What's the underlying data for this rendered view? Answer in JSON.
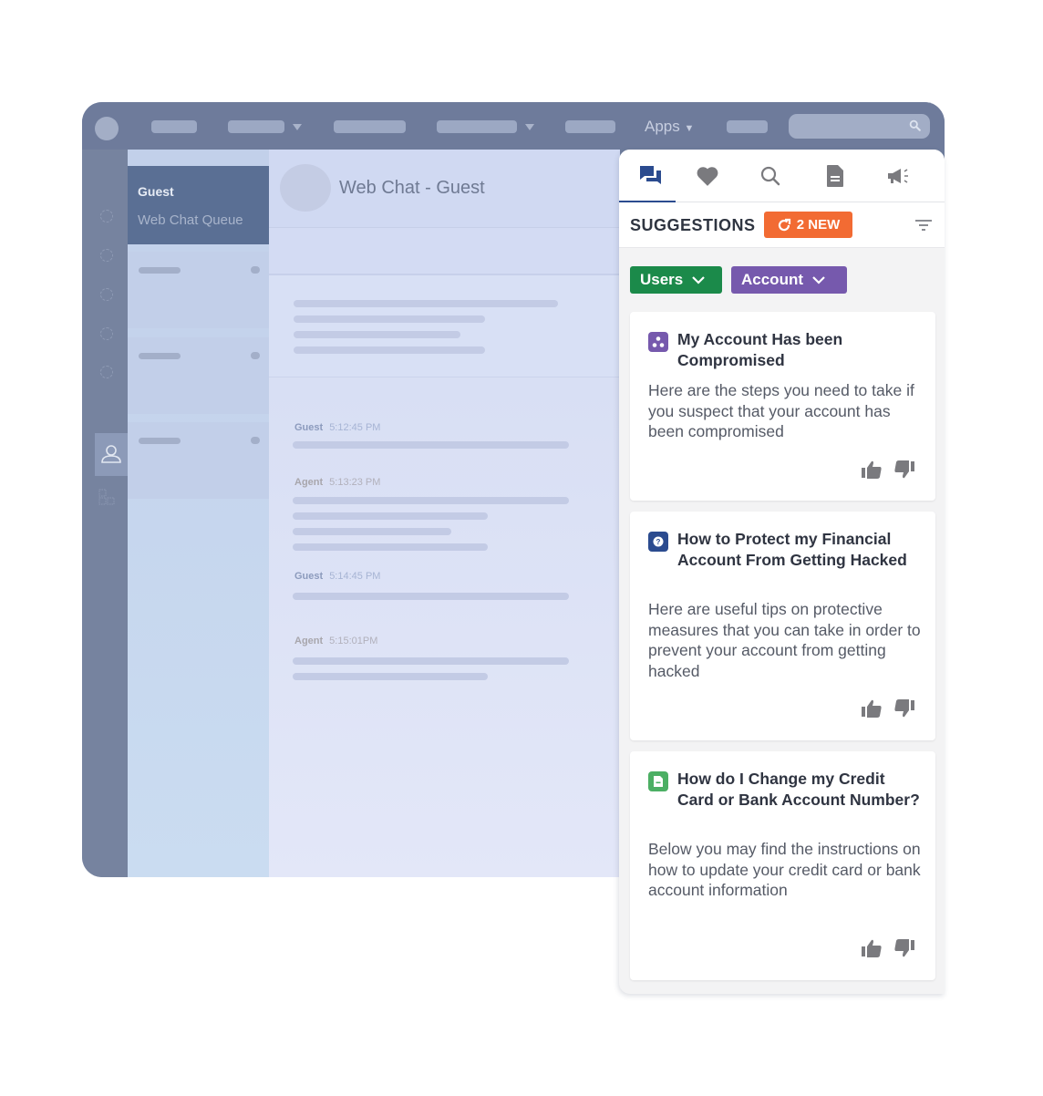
{
  "topbar": {
    "apps_label": "Apps",
    "search_icon": "search-icon"
  },
  "queue": {
    "active": {
      "name": "Guest",
      "queue": "Web Chat Queue"
    }
  },
  "chat": {
    "title": "Web Chat - Guest",
    "messages": [
      {
        "sender": "Guest",
        "time": "5:12:45 PM"
      },
      {
        "sender": "Agent",
        "time": "5:13:23 PM"
      },
      {
        "sender": "Guest",
        "time": "5:14:45 PM"
      },
      {
        "sender": "Agent",
        "time": "5:15:01PM"
      }
    ]
  },
  "panel": {
    "tabs": [
      {
        "icon": "chat-bubbles-icon",
        "active": true
      },
      {
        "icon": "heart-icon",
        "active": false
      },
      {
        "icon": "search-icon",
        "active": false
      },
      {
        "icon": "document-icon",
        "active": false
      },
      {
        "icon": "megaphone-icon",
        "active": false
      }
    ],
    "header": {
      "title": "SUGGESTIONS",
      "new_badge": "2 NEW",
      "accent": "#f26b33"
    },
    "filters": [
      {
        "label": "Users",
        "color": "#1b8a4a"
      },
      {
        "label": "Account",
        "color": "#7659ad"
      }
    ],
    "cards": [
      {
        "icon": "hierarchy-icon",
        "icon_color": "#7659ad",
        "title": "My Account Has been Compromised",
        "body": "Here are the steps  you need to take if you suspect that your account has been compromised"
      },
      {
        "icon": "question-bubble-icon",
        "icon_color": "#2b4b8f",
        "title": "How to Protect my Financial Account From Getting Hacked",
        "body": "Here are useful tips on protective measures that you can take in order to prevent your account from getting hacked"
      },
      {
        "icon": "document-icon",
        "icon_color": "#4caf64",
        "title": "How do I Change my Credit Card or Bank Account Number?",
        "body": "Below you may find the instructions on how to update your credit card or bank account information"
      }
    ]
  }
}
